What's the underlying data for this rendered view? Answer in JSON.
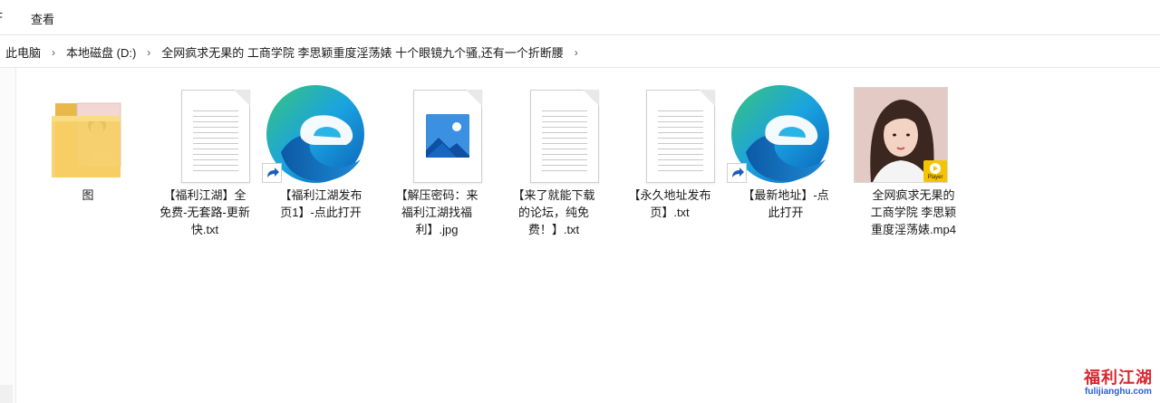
{
  "ribbon": {
    "tab_left_fragment": "F",
    "tab_view": "查看"
  },
  "breadcrumb": [
    "此电脑",
    "本地磁盘 (D:)",
    "全网疯求无果的 工商学院 李思颖重度淫荡婊 十个眼镜九个骚,还有一个折断腰"
  ],
  "files": [
    {
      "name": "图",
      "type": "folder"
    },
    {
      "name": "【福利江湖】全免费-无套路-更新快.txt",
      "type": "txt"
    },
    {
      "name": "【福利江湖发布页1】-点此打开",
      "type": "edge-shortcut"
    },
    {
      "name": "【解压密码：来福利江湖找福利】.jpg",
      "type": "jpg"
    },
    {
      "name": "【来了就能下载的论坛，纯免费！】.txt",
      "type": "txt"
    },
    {
      "name": "【永久地址发布页】.txt",
      "type": "txt"
    },
    {
      "name": "【最新地址】-点此打开",
      "type": "edge-shortcut"
    },
    {
      "name": "全网疯求无果的工商学院 李思颖重度淫荡婊.mp4",
      "type": "mp4",
      "badge": "Player"
    }
  ],
  "watermark": {
    "text": "福利江湖",
    "domain": "fulijianghu.com"
  },
  "colors": {
    "accent_blue": "#2b5bd7",
    "watermark_red": "#d9272e"
  }
}
